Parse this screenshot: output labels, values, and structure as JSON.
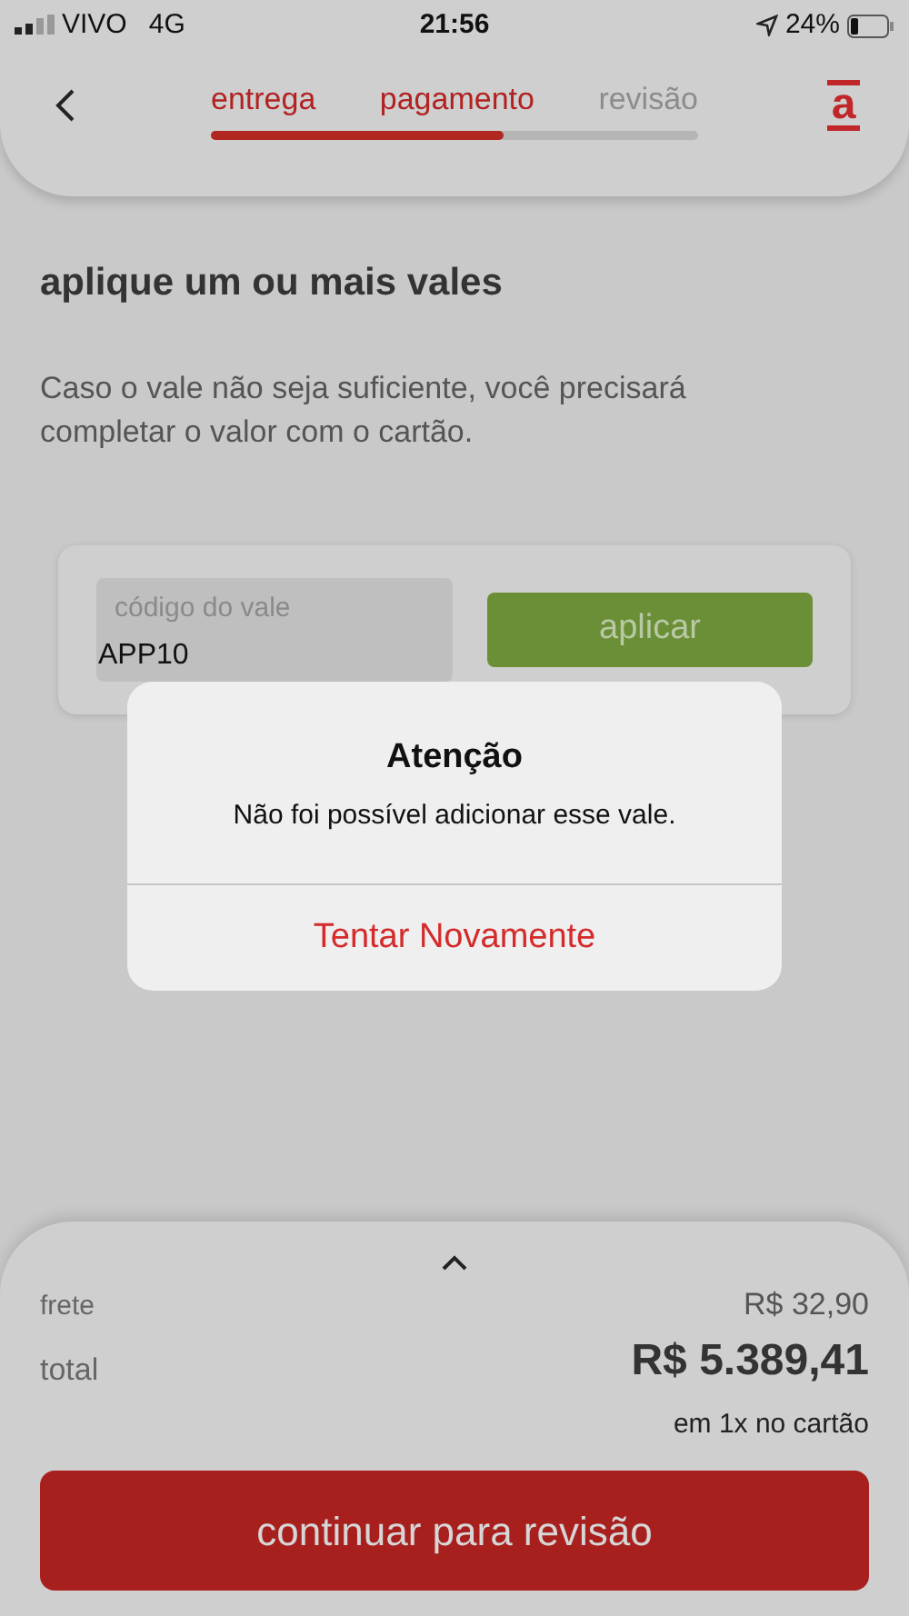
{
  "status_bar": {
    "carrier": "VIVO",
    "network": "4G",
    "time": "21:56",
    "battery": "24%"
  },
  "header": {
    "steps": [
      {
        "label": "entrega",
        "done": true
      },
      {
        "label": "pagamento",
        "done": true
      },
      {
        "label": "revisão",
        "done": false
      }
    ],
    "progress": {
      "level": 0.6
    },
    "logo": "a"
  },
  "title": "aplique um ou mais vales",
  "description": "Caso o vale não seja suficiente, você precisará completar o valor com o cartão.",
  "voucher": {
    "label": "código do vale",
    "value": "APP10",
    "button": "aplicar"
  },
  "alert": {
    "title": "Atenção",
    "message": "Não foi possível adicionar esse vale.",
    "action": "Tentar Novamente"
  },
  "summary": {
    "rows": [
      {
        "kind": "normal",
        "label": "frete",
        "value": "R$ 32,90"
      },
      {
        "kind": "total",
        "label": "total",
        "value": "R$ 5.389,41"
      }
    ],
    "note": "em 1x no cartão",
    "button": "continuar para revisão"
  }
}
